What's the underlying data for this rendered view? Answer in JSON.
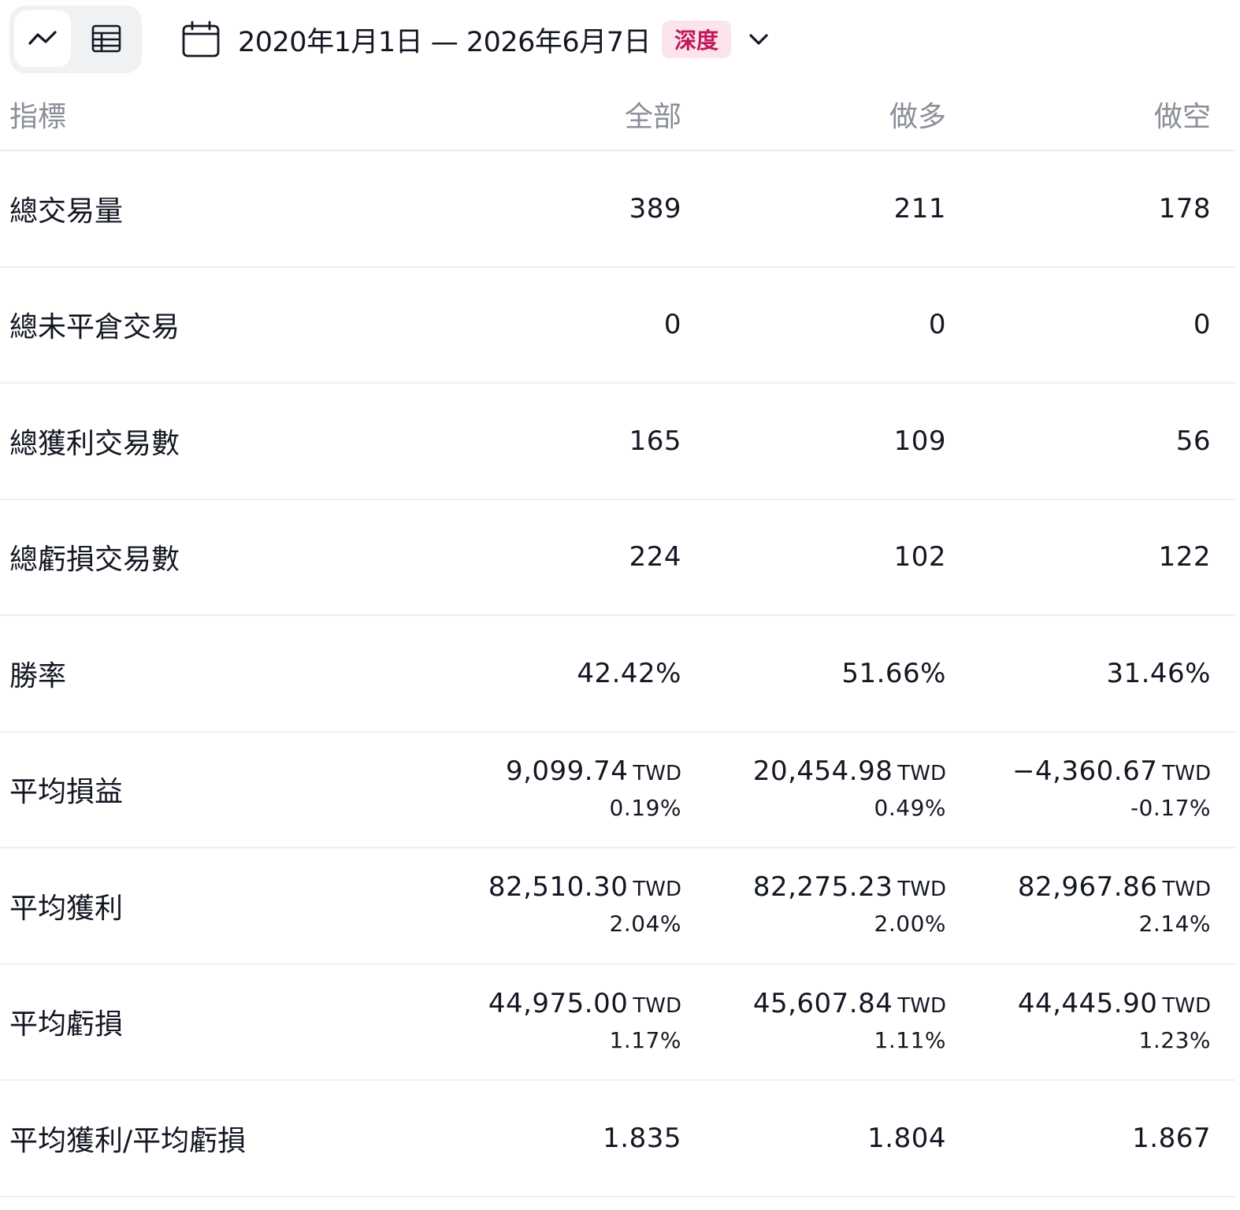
{
  "toolbar": {
    "chart_view_icon": "line-chart-icon",
    "table_view_icon": "table-icon",
    "calendar_icon": "calendar-icon",
    "date_range": "2020年1月1日 — 2026年6月7日",
    "badge": "深度",
    "dropdown_icon": "chevron-down-icon",
    "badge_bg": "#fce4ec",
    "badge_color": "#c2185b"
  },
  "table": {
    "headers": {
      "metric": "指標",
      "all": "全部",
      "long": "做多",
      "short": "做空"
    },
    "rows": [
      {
        "label": "總交易量",
        "all": "389",
        "long": "211",
        "short": "178"
      },
      {
        "label": "總未平倉交易",
        "all": "0",
        "long": "0",
        "short": "0"
      },
      {
        "label": "總獲利交易數",
        "all": "165",
        "long": "109",
        "short": "56"
      },
      {
        "label": "總虧損交易數",
        "all": "224",
        "long": "102",
        "short": "122"
      },
      {
        "label": "勝率",
        "all": "42.42%",
        "long": "51.66%",
        "short": "31.46%"
      },
      {
        "label": "平均損益",
        "all": "9,099.74",
        "all_unit": "TWD",
        "all_pct": "0.19%",
        "long": "20,454.98",
        "long_unit": "TWD",
        "long_pct": "0.49%",
        "short": "−4,360.67",
        "short_unit": "TWD",
        "short_pct": "-0.17%"
      },
      {
        "label": "平均獲利",
        "all": "82,510.30",
        "all_unit": "TWD",
        "all_pct": "2.04%",
        "long": "82,275.23",
        "long_unit": "TWD",
        "long_pct": "2.00%",
        "short": "82,967.86",
        "short_unit": "TWD",
        "short_pct": "2.14%"
      },
      {
        "label": "平均虧損",
        "all": "44,975.00",
        "all_unit": "TWD",
        "all_pct": "1.17%",
        "long": "45,607.84",
        "long_unit": "TWD",
        "long_pct": "1.11%",
        "short": "44,445.90",
        "short_unit": "TWD",
        "short_pct": "1.23%"
      },
      {
        "label": "平均獲利/平均虧損",
        "all": "1.835",
        "long": "1.804",
        "short": "1.867"
      }
    ]
  }
}
